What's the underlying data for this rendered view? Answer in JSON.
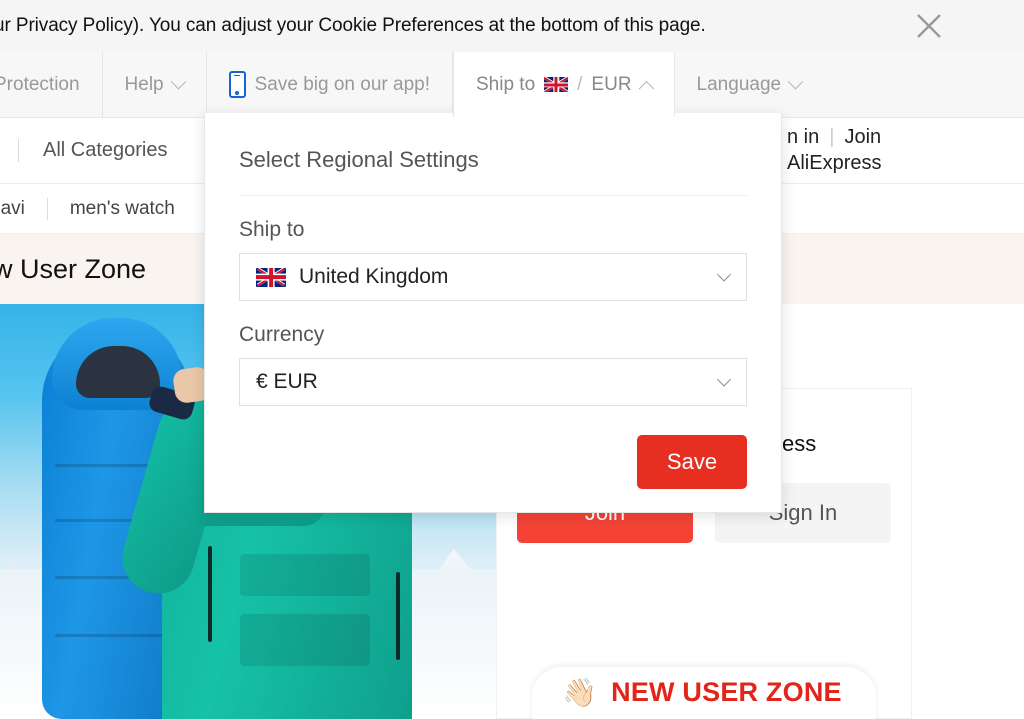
{
  "cookie_banner": {
    "text": "ur Privacy Policy). You can adjust your Cookie Preferences at the bottom of this page.",
    "close_icon": "close-icon"
  },
  "topnav": {
    "items": [
      {
        "label": "Protection",
        "icon": null,
        "caret": null,
        "active": false
      },
      {
        "label": "Help",
        "icon": null,
        "caret": "down",
        "active": false
      },
      {
        "label": "Save big on our app!",
        "icon": "mobile-phone-icon",
        "caret": null,
        "active": false
      },
      {
        "label": "Ship to",
        "icon": "uk-flag-icon",
        "separator": "/",
        "currency": "EUR",
        "caret": "up",
        "active": true
      },
      {
        "label": "Language",
        "icon": null,
        "caret": "down",
        "active": false
      }
    ]
  },
  "search_row": {
    "all_categories": "All Categories"
  },
  "account": {
    "sign_in": "n in",
    "separator": "|",
    "join": "Join",
    "brand": "AliExpress"
  },
  "hotwords": [
    {
      "label": "navi"
    },
    {
      "label": "men's watch"
    }
  ],
  "new_user_band": {
    "title": "ew User Zone"
  },
  "welcome_card": {
    "title": "Welcome to AliExpress",
    "join_label": "Join",
    "signin_label": "Sign In",
    "badge_emoji": "👋🏻",
    "badge_text": "NEW USER ZONE"
  },
  "region_popup": {
    "title": "Select Regional Settings",
    "ship_to_label": "Ship to",
    "ship_to_value": "United Kingdom",
    "ship_to_flag": "uk-flag-icon",
    "currency_label": "Currency",
    "currency_value": "€ EUR",
    "save_label": "Save"
  },
  "colors": {
    "brand_red": "#e62e21",
    "join_red": "#f44336",
    "badge_red": "#e1251b",
    "banner_bg": "#f5f5f5",
    "nav_bg": "#f7f7f7",
    "band_bg": "#faf4f1",
    "phone_blue": "#1565d8"
  }
}
